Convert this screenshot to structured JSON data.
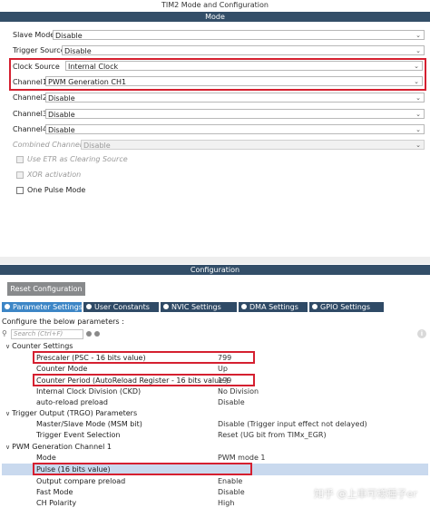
{
  "window": {
    "title": "TIM2 Mode and Configuration"
  },
  "mode": {
    "header": "Mode",
    "rows": [
      {
        "label": "Slave Mode",
        "value": "Disable"
      },
      {
        "label": "Trigger Source",
        "value": "Disable"
      },
      {
        "label": "Clock Source",
        "value": "Internal Clock"
      },
      {
        "label": "Channel1",
        "value": "PWM Generation CH1"
      },
      {
        "label": "Channel2",
        "value": "Disable"
      },
      {
        "label": "Channel3",
        "value": "Disable"
      },
      {
        "label": "Channel4",
        "value": "Disable"
      },
      {
        "label": "Combined Channels",
        "value": "Disable"
      }
    ],
    "checkboxes": [
      {
        "label": "Use ETR as Clearing Source"
      },
      {
        "label": "XOR activation"
      },
      {
        "label": "One Pulse Mode"
      }
    ]
  },
  "configuration": {
    "header": "Configuration",
    "reset_button": "Reset Configuration",
    "tabs": [
      {
        "label": "Parameter Settings"
      },
      {
        "label": "User Constants"
      },
      {
        "label": "NVIC Settings"
      },
      {
        "label": "DMA Settings"
      },
      {
        "label": "GPIO Settings"
      }
    ],
    "hint": "Configure the below parameters :",
    "search_placeholder": "Search (Ctrl+F)",
    "groups": [
      {
        "name": "Counter Settings",
        "params": [
          {
            "name": "Prescaler (PSC - 16 bits value)",
            "value": "799"
          },
          {
            "name": "Counter Mode",
            "value": "Up"
          },
          {
            "name": "Counter Period (AutoReload Register - 16 bits value )",
            "value": "199"
          },
          {
            "name": "Internal Clock Division (CKD)",
            "value": "No Division"
          },
          {
            "name": "auto-reload preload",
            "value": "Disable"
          }
        ]
      },
      {
        "name": "Trigger Output (TRGO) Parameters",
        "params": [
          {
            "name": "Master/Slave Mode (MSM bit)",
            "value": "Disable (Trigger input effect not delayed)"
          },
          {
            "name": "Trigger Event Selection",
            "value": "Reset (UG bit from TIMx_EGR)"
          }
        ]
      },
      {
        "name": "PWM Generation Channel 1",
        "params": [
          {
            "name": "Mode",
            "value": "PWM mode 1"
          },
          {
            "name": "Pulse (16 bits value)",
            "value": ""
          },
          {
            "name": "Output compare preload",
            "value": "Enable"
          },
          {
            "name": "Fast Mode",
            "value": "Disable"
          },
          {
            "name": "CH Polarity",
            "value": "High"
          }
        ]
      }
    ]
  },
  "watermark": "知乎 @上車可樣種子er",
  "colors": {
    "header_bar": "#334e68",
    "tab_active": "#3d86c6",
    "tab": "#2f4a66",
    "highlight_box": "#d52030",
    "selected_row": "#c9d9ee"
  }
}
